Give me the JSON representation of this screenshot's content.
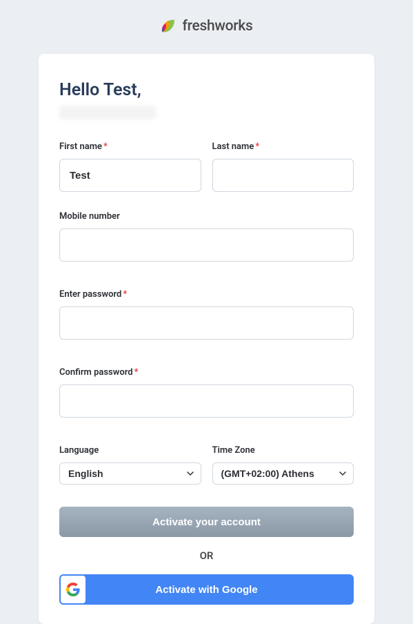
{
  "brand": {
    "name": "freshworks"
  },
  "greeting": "Hello Test,",
  "fields": {
    "first_name": {
      "label": "First name",
      "value": "Test"
    },
    "last_name": {
      "label": "Last name",
      "value": ""
    },
    "mobile": {
      "label": "Mobile number",
      "value": ""
    },
    "password": {
      "label": "Enter password",
      "value": ""
    },
    "confirm_password": {
      "label": "Confirm password",
      "value": ""
    },
    "language": {
      "label": "Language",
      "selected": "English"
    },
    "timezone": {
      "label": "Time Zone",
      "selected": "(GMT+02:00) Athens"
    }
  },
  "buttons": {
    "activate": "Activate your account",
    "or": "OR",
    "google": "Activate with Google"
  }
}
